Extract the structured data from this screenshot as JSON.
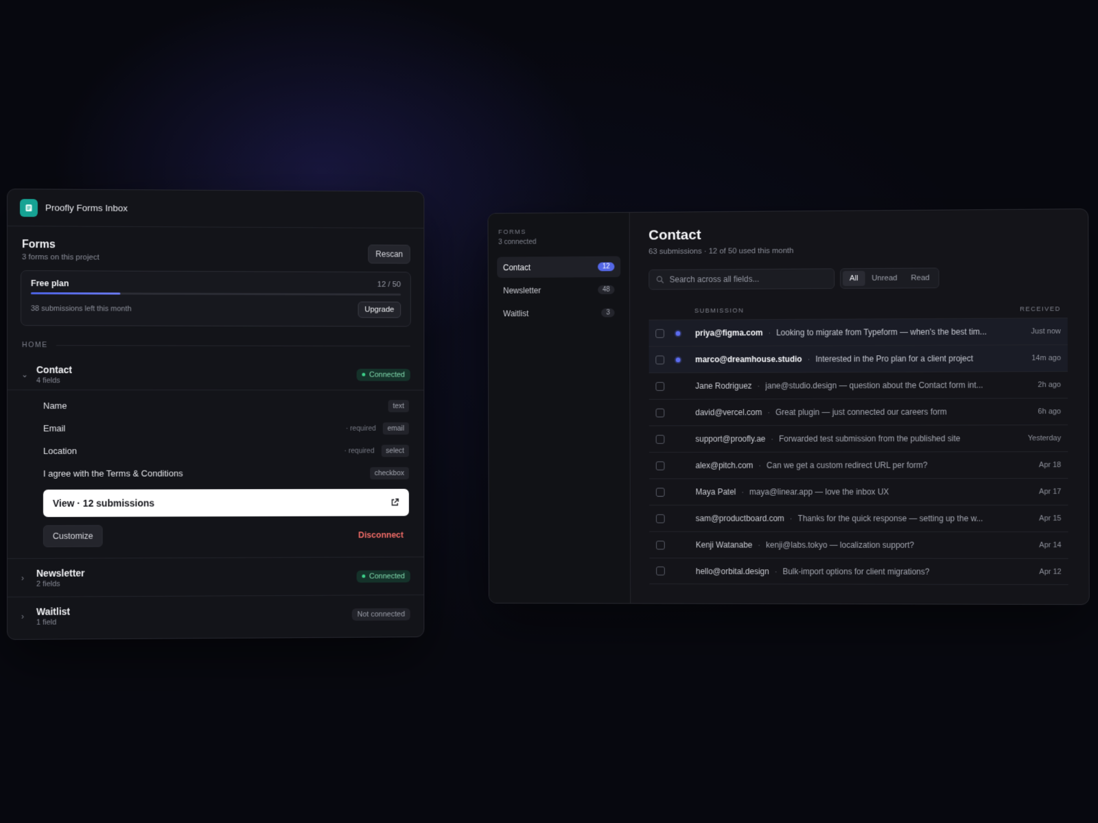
{
  "app": {
    "title": "Proofly Forms Inbox"
  },
  "left": {
    "forms_title": "Forms",
    "forms_sub": "3 forms on this project",
    "rescan_label": "Rescan",
    "plan": {
      "name": "Free plan",
      "usage": "12 / 50",
      "used": 12,
      "limit": 50,
      "left_text": "38 submissions left this month",
      "upgrade_label": "Upgrade"
    },
    "section_label": "HOME",
    "forms": [
      {
        "name": "Contact",
        "sub": "4 fields",
        "status": "Connected",
        "status_kind": "ok"
      },
      {
        "name": "Newsletter",
        "sub": "2 fields",
        "status": "Connected",
        "status_kind": "ok"
      },
      {
        "name": "Waitlist",
        "sub": "1 field",
        "status": "Not connected",
        "status_kind": "no"
      }
    ],
    "fields": [
      {
        "name": "Name",
        "req": "",
        "type": "text"
      },
      {
        "name": "Email",
        "req": "· required",
        "type": "email"
      },
      {
        "name": "Location",
        "req": "· required",
        "type": "select"
      },
      {
        "name": "I agree with the Terms & Conditions",
        "req": "",
        "type": "checkbox"
      }
    ],
    "view_label": "View · 12 submissions",
    "customize_label": "Customize",
    "disconnect_label": "Disconnect"
  },
  "right": {
    "sidebar": {
      "label": "FORMS",
      "sub": "3 connected",
      "items": [
        {
          "label": "Contact",
          "count": "12",
          "active": true
        },
        {
          "label": "Newsletter",
          "count": "48"
        },
        {
          "label": "Waitlist",
          "count": "3"
        }
      ]
    },
    "title": "Contact",
    "sub": "63 submissions · 12 of 50 used this month",
    "search_placeholder": "Search across all fields...",
    "filters": [
      "All",
      "Unread",
      "Read"
    ],
    "columns": {
      "submission": "SUBMISSION",
      "received": "RECEIVED"
    },
    "rows": [
      {
        "sender": "priya@figma.com",
        "preview": "Looking to migrate from Typeform — when's the best tim...",
        "time": "Just now",
        "unread": true
      },
      {
        "sender": "marco@dreamhouse.studio",
        "preview": "Interested in the Pro plan for a client project",
        "time": "14m ago",
        "unread": true
      },
      {
        "sender": "Jane Rodriguez",
        "preview": "jane@studio.design — question about the Contact form int...",
        "time": "2h ago",
        "unread": false
      },
      {
        "sender": "david@vercel.com",
        "preview": "Great plugin — just connected our careers form",
        "time": "6h ago",
        "unread": false
      },
      {
        "sender": "support@proofly.ae",
        "preview": "Forwarded test submission from the published site",
        "time": "Yesterday",
        "unread": false
      },
      {
        "sender": "alex@pitch.com",
        "preview": "Can we get a custom redirect URL per form?",
        "time": "Apr 18",
        "unread": false
      },
      {
        "sender": "Maya Patel",
        "preview": "maya@linear.app — love the inbox UX",
        "time": "Apr 17",
        "unread": false
      },
      {
        "sender": "sam@productboard.com",
        "preview": "Thanks for the quick response — setting up the w...",
        "time": "Apr 15",
        "unread": false
      },
      {
        "sender": "Kenji Watanabe",
        "preview": "kenji@labs.tokyo — localization support?",
        "time": "Apr 14",
        "unread": false
      },
      {
        "sender": "hello@orbital.design",
        "preview": "Bulk-import options for client migrations?",
        "time": "Apr 12",
        "unread": false
      }
    ]
  },
  "colors": {
    "accent": "#5467e6",
    "brand": "#16a394",
    "connected": "#3ccf89",
    "danger": "#ef6b66"
  }
}
